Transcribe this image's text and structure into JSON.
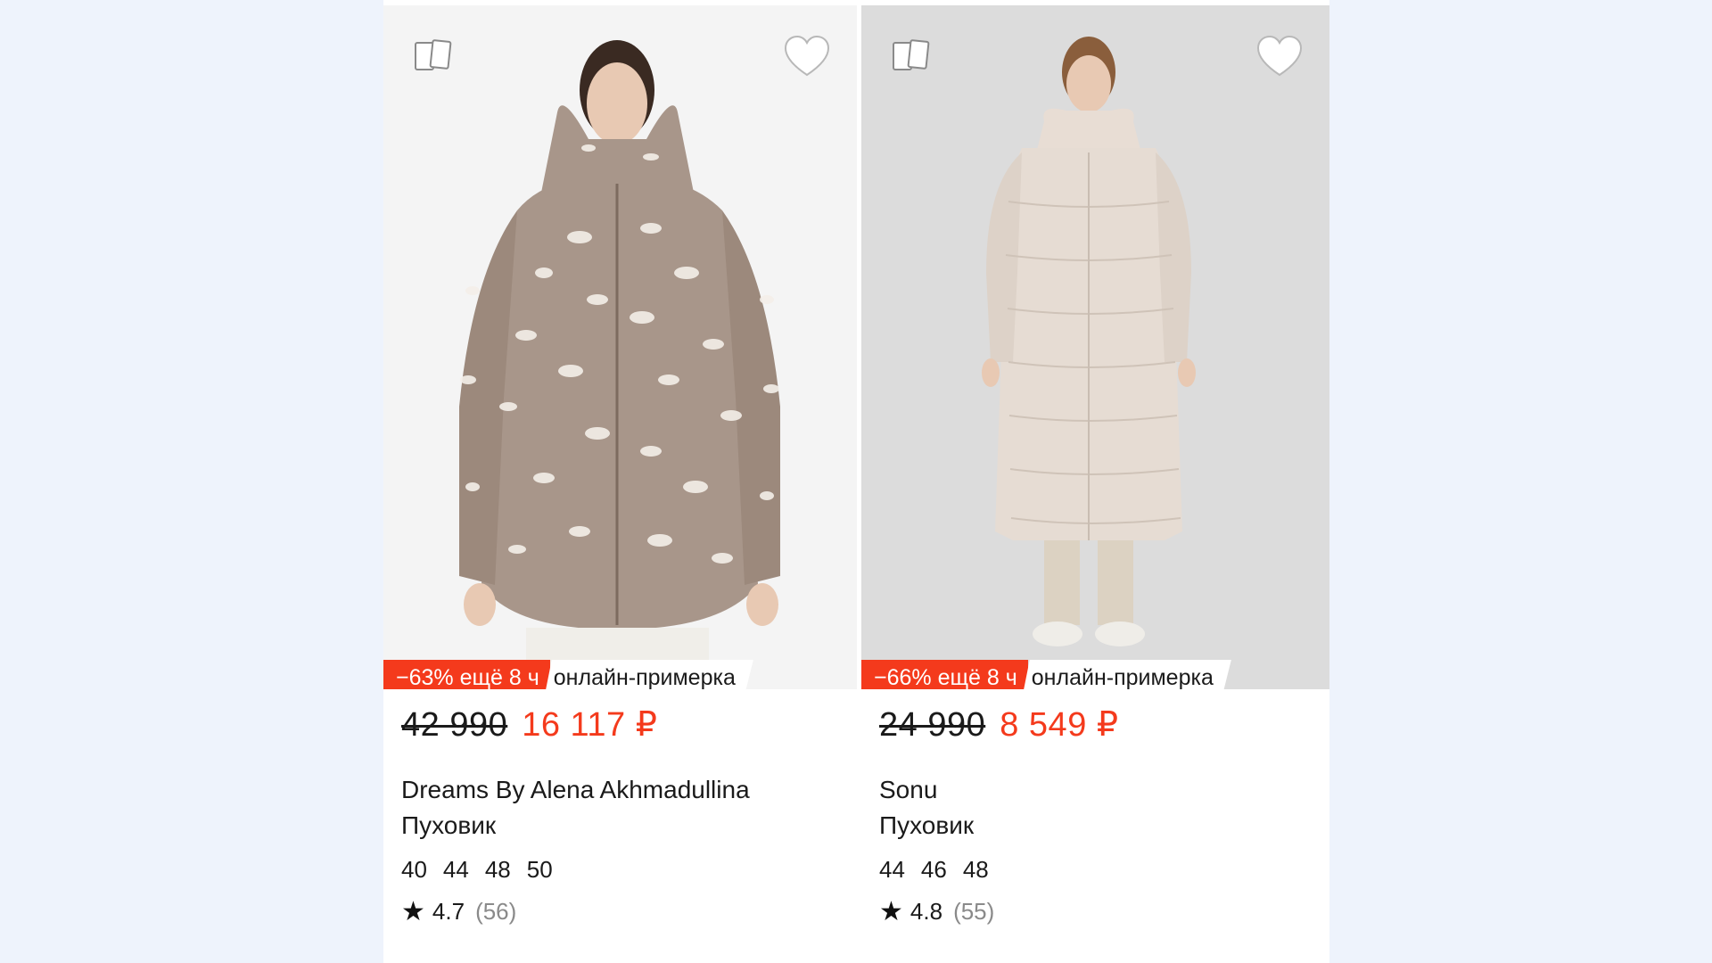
{
  "products": [
    {
      "promo": {
        "discount": "−63% ещё 8 ч",
        "tryon": "онлайн-примерка"
      },
      "old_price": "42 990",
      "new_price": "16 117 ₽",
      "brand": "Dreams By Alena Akhmadullina",
      "title": "Пуховик",
      "sizes": [
        "40",
        "44",
        "48",
        "50"
      ],
      "rating": {
        "score": "4.7",
        "count": "(56)"
      }
    },
    {
      "promo": {
        "discount": "−66% ещё 8 ч",
        "tryon": "онлайн-примерка"
      },
      "old_price": "24 990",
      "new_price": "8 549 ₽",
      "brand": "Sonu",
      "title": "Пуховик",
      "sizes": [
        "44",
        "46",
        "48"
      ],
      "rating": {
        "score": "4.8",
        "count": "(55)"
      }
    }
  ],
  "icons": {
    "compare": "compare-icon",
    "favorite": "heart-icon",
    "rating": "star-icon"
  },
  "colors": {
    "accent": "#f43a1c",
    "background": "#eef3fc",
    "card": "#ffffff"
  }
}
